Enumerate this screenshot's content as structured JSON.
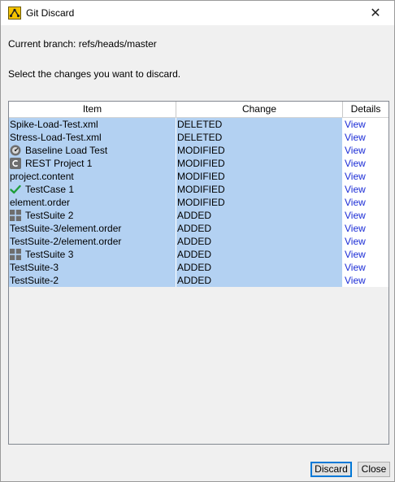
{
  "window": {
    "title": "Git Discard",
    "close_glyph": "✕"
  },
  "branch_text": "Current branch: refs/heads/master",
  "instruction_text": "Select the changes you want to discard.",
  "table": {
    "columns": {
      "item": "Item",
      "change": "Change",
      "details": "Details"
    },
    "rows": [
      {
        "item": "Spike-Load-Test.xml",
        "icon": "",
        "change": "DELETED",
        "details": "View"
      },
      {
        "item": "Stress-Load-Test.xml",
        "icon": "",
        "change": "DELETED",
        "details": "View"
      },
      {
        "item": "Baseline Load Test",
        "icon": "load-test-icon",
        "change": "MODIFIED",
        "details": "View"
      },
      {
        "item": "REST Project 1",
        "icon": "rest-project-icon",
        "change": "MODIFIED",
        "details": "View"
      },
      {
        "item": "project.content",
        "icon": "",
        "change": "MODIFIED",
        "details": "View"
      },
      {
        "item": "TestCase 1",
        "icon": "testcase-check-icon",
        "change": "MODIFIED",
        "details": "View"
      },
      {
        "item": "element.order",
        "icon": "",
        "change": "MODIFIED",
        "details": "View"
      },
      {
        "item": "TestSuite 2",
        "icon": "testsuite-grid-icon",
        "change": "ADDED",
        "details": "View"
      },
      {
        "item": "TestSuite-3/element.order",
        "icon": "",
        "change": "ADDED",
        "details": "View"
      },
      {
        "item": "TestSuite-2/element.order",
        "icon": "",
        "change": "ADDED",
        "details": "View"
      },
      {
        "item": "TestSuite 3",
        "icon": "testsuite-grid-icon",
        "change": "ADDED",
        "details": "View"
      },
      {
        "item": "TestSuite-3",
        "icon": "",
        "change": "ADDED",
        "details": "View"
      },
      {
        "item": "TestSuite-2",
        "icon": "",
        "change": "ADDED",
        "details": "View"
      }
    ]
  },
  "buttons": {
    "discard": "Discard",
    "close": "Close"
  },
  "colors": {
    "selection": "#b3d1f2",
    "link": "#1a2bd6",
    "dialog_bg": "#f0f0f0",
    "focus_border": "#0078d7"
  }
}
